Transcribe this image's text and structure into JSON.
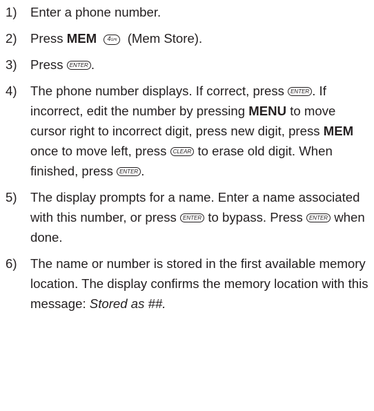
{
  "keys": {
    "enter": "ENTER",
    "clear": "CLEAR",
    "four_digit": "4",
    "four_letters": "GHI"
  },
  "steps": [
    {
      "number": "1)",
      "text": "Enter a phone number."
    },
    {
      "number": "2)",
      "press": "Press",
      "mem": "MEM",
      "suffix": "(Mem Store)."
    },
    {
      "number": "3)",
      "press": "Press",
      "end": "."
    },
    {
      "number": "4)",
      "a": "The phone number displays. If correct, press",
      "b": ". If incorrect, edit the number by pressing",
      "menu": "MENU",
      "c": "to move cursor right to incorrect digit, press new digit, press",
      "mem": "MEM",
      "d": "once to move left, press",
      "e": "to erase old digit. When finished, press",
      "end": "."
    },
    {
      "number": "5)",
      "a": "The display prompts for a name. Enter a name associated with this number, or press",
      "b": "to bypass. Press",
      "c": "when done."
    },
    {
      "number": "6)",
      "a": "The name or number is stored in the first available memory location. The display confirms the memory location with this message:",
      "italic": "Stored as ##."
    }
  ]
}
